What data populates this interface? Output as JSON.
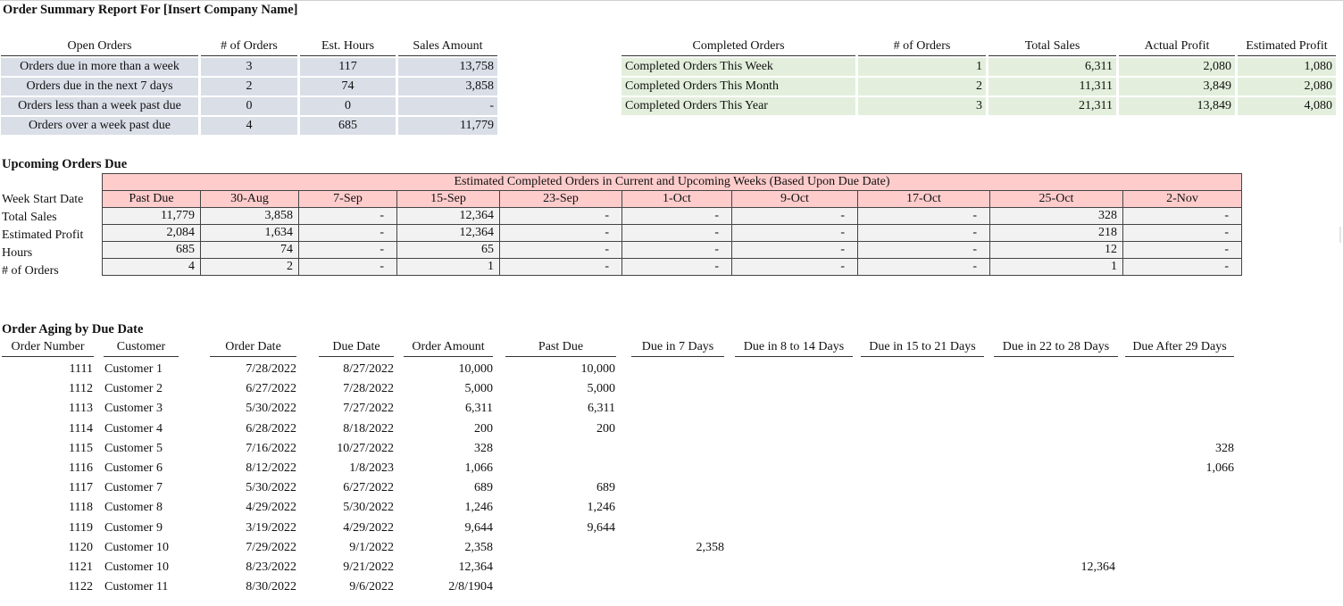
{
  "report": {
    "title": "Order Summary Report For [Insert Company Name]"
  },
  "open_orders": {
    "headers": [
      "Open Orders",
      "# of Orders",
      "Est. Hours",
      "Sales Amount"
    ],
    "rows": [
      {
        "label": "Orders due in more than a week",
        "orders": "3",
        "hours": "117",
        "sales": "13,758"
      },
      {
        "label": "Orders due in the next 7 days",
        "orders": "2",
        "hours": "74",
        "sales": "3,858"
      },
      {
        "label": "Orders less than a week past due",
        "orders": "0",
        "hours": "0",
        "sales": "-"
      },
      {
        "label": "Orders over a week past due",
        "orders": "4",
        "hours": "685",
        "sales": "11,779"
      }
    ]
  },
  "completed_orders": {
    "headers": [
      "Completed Orders",
      "# of Orders",
      "Total Sales",
      "Actual Profit",
      "Estimated Profit"
    ],
    "rows": [
      {
        "label": "Completed Orders This Week",
        "orders": "1",
        "sales": "6,311",
        "actual": "2,080",
        "estimated": "1,080"
      },
      {
        "label": "Completed Orders This Month",
        "orders": "2",
        "sales": "11,311",
        "actual": "3,849",
        "estimated": "2,080"
      },
      {
        "label": "Completed Orders This Year",
        "orders": "3",
        "sales": "21,311",
        "actual": "13,849",
        "estimated": "4,080"
      }
    ]
  },
  "upcoming": {
    "section_title": "Upcoming Orders Due",
    "banner": "Estimated Completed Orders in Current and Upcoming Weeks (Based Upon Due Date)",
    "row_labels": [
      "Week Start Date",
      "Total Sales",
      "Estimated Profit",
      "Hours",
      "# of Orders"
    ],
    "weeks": [
      "Past Due",
      "30-Aug",
      "7-Sep",
      "15-Sep",
      "23-Sep",
      "1-Oct",
      "9-Oct",
      "17-Oct",
      "25-Oct",
      "2-Nov"
    ],
    "total_sales": [
      "11,779",
      "3,858",
      "-",
      "12,364",
      "-",
      "-",
      "-",
      "-",
      "328",
      "-"
    ],
    "estimated_profit": [
      "2,084",
      "1,634",
      "-",
      "12,364",
      "-",
      "-",
      "-",
      "-",
      "218",
      "-"
    ],
    "hours": [
      "685",
      "74",
      "-",
      "65",
      "-",
      "-",
      "-",
      "-",
      "12",
      "-"
    ],
    "num_orders": [
      "4",
      "2",
      "-",
      "1",
      "-",
      "-",
      "-",
      "-",
      "1",
      "-"
    ]
  },
  "aging": {
    "section_title": "Order Aging by Due Date",
    "headers": [
      "Order Number",
      "Customer",
      "Order Date",
      "Due Date",
      "Order Amount",
      "Past Due",
      "Due in 7 Days",
      "Due in 8 to 14 Days",
      "Due in 15 to 21 Days",
      "Due in 22 to 28 Days",
      "Due After 29 Days"
    ],
    "rows": [
      {
        "num": "1111",
        "customer": "Customer 1",
        "order_date": "7/28/2022",
        "due_date": "8/27/2022",
        "amount": "10,000",
        "past_due": "10,000",
        "d7": "",
        "d14": "",
        "d21": "",
        "d28": "",
        "d29": ""
      },
      {
        "num": "1112",
        "customer": "Customer 2",
        "order_date": "6/27/2022",
        "due_date": "7/28/2022",
        "amount": "5,000",
        "past_due": "5,000",
        "d7": "",
        "d14": "",
        "d21": "",
        "d28": "",
        "d29": ""
      },
      {
        "num": "1113",
        "customer": "Customer 3",
        "order_date": "5/30/2022",
        "due_date": "7/27/2022",
        "amount": "6,311",
        "past_due": "6,311",
        "d7": "",
        "d14": "",
        "d21": "",
        "d28": "",
        "d29": ""
      },
      {
        "num": "1114",
        "customer": "Customer 4",
        "order_date": "6/28/2022",
        "due_date": "8/18/2022",
        "amount": "200",
        "past_due": "200",
        "d7": "",
        "d14": "",
        "d21": "",
        "d28": "",
        "d29": ""
      },
      {
        "num": "1115",
        "customer": "Customer 5",
        "order_date": "7/16/2022",
        "due_date": "10/27/2022",
        "amount": "328",
        "past_due": "",
        "d7": "",
        "d14": "",
        "d21": "",
        "d28": "",
        "d29": "328"
      },
      {
        "num": "1116",
        "customer": "Customer 6",
        "order_date": "8/12/2022",
        "due_date": "1/8/2023",
        "amount": "1,066",
        "past_due": "",
        "d7": "",
        "d14": "",
        "d21": "",
        "d28": "",
        "d29": "1,066"
      },
      {
        "num": "1117",
        "customer": "Customer 7",
        "order_date": "5/30/2022",
        "due_date": "6/27/2022",
        "amount": "689",
        "past_due": "689",
        "d7": "",
        "d14": "",
        "d21": "",
        "d28": "",
        "d29": ""
      },
      {
        "num": "1118",
        "customer": "Customer 8",
        "order_date": "4/29/2022",
        "due_date": "5/30/2022",
        "amount": "1,246",
        "past_due": "1,246",
        "d7": "",
        "d14": "",
        "d21": "",
        "d28": "",
        "d29": ""
      },
      {
        "num": "1119",
        "customer": "Customer 9",
        "order_date": "3/19/2022",
        "due_date": "4/29/2022",
        "amount": "9,644",
        "past_due": "9,644",
        "d7": "",
        "d14": "",
        "d21": "",
        "d28": "",
        "d29": ""
      },
      {
        "num": "1120",
        "customer": "Customer 10",
        "order_date": "7/29/2022",
        "due_date": "9/1/2022",
        "amount": "2,358",
        "past_due": "",
        "d7": "2,358",
        "d14": "",
        "d21": "",
        "d28": "",
        "d29": ""
      },
      {
        "num": "1121",
        "customer": "Customer 10",
        "order_date": "8/23/2022",
        "due_date": "9/21/2022",
        "amount": "12,364",
        "past_due": "",
        "d7": "",
        "d14": "",
        "d21": "",
        "d28": "12,364",
        "d29": ""
      },
      {
        "num": "1122",
        "customer": "Customer 11",
        "order_date": "8/30/2022",
        "due_date": "9/6/2022",
        "amount": "2/8/1904",
        "past_due": "",
        "d7": "",
        "d14": "",
        "d21": "",
        "d28": "",
        "d29": ""
      }
    ]
  },
  "colors": {
    "open_fill": "#d9dee7",
    "completed_fill": "#e3efdc",
    "banner_fill": "#ffcccc",
    "grid_fill": "#f2f2f2"
  }
}
